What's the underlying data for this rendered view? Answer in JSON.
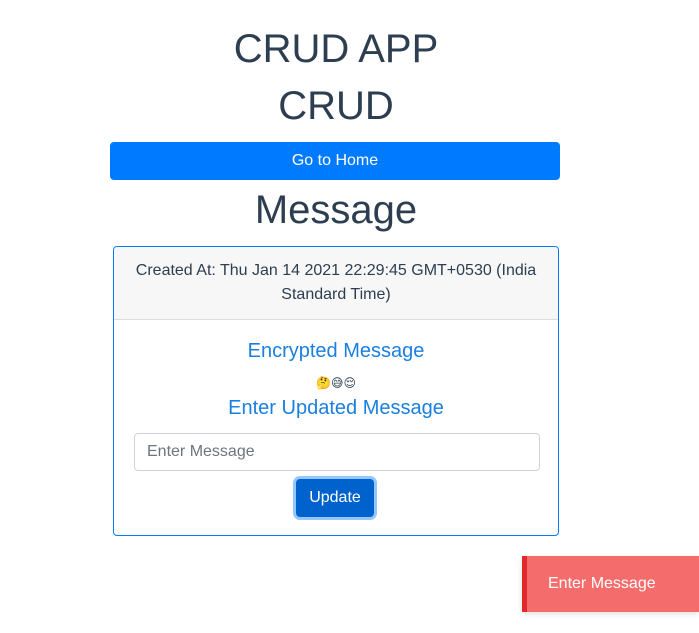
{
  "header": {
    "app_title": "CRUD APP",
    "subtitle": "CRUD"
  },
  "nav": {
    "home_button_label": "Go to Home"
  },
  "main": {
    "section_title": "Message",
    "card": {
      "created_at": "Created At: Thu Jan 14 2021 22:29:45 GMT+0530 (India Standard Time)",
      "encrypted_title": "Encrypted Message",
      "encrypted_content": "🤔😅😌",
      "update_title": "Enter Updated Message",
      "input_placeholder": "Enter Message",
      "input_value": "",
      "update_button_label": "Update"
    }
  },
  "toast": {
    "message": "Enter Message",
    "type": "error",
    "color": "#f56c6c",
    "accent_color": "#e0292b"
  },
  "colors": {
    "primary": "#007bff",
    "heading_text": "#2c3e50",
    "link_text": "#1a7fe0"
  }
}
